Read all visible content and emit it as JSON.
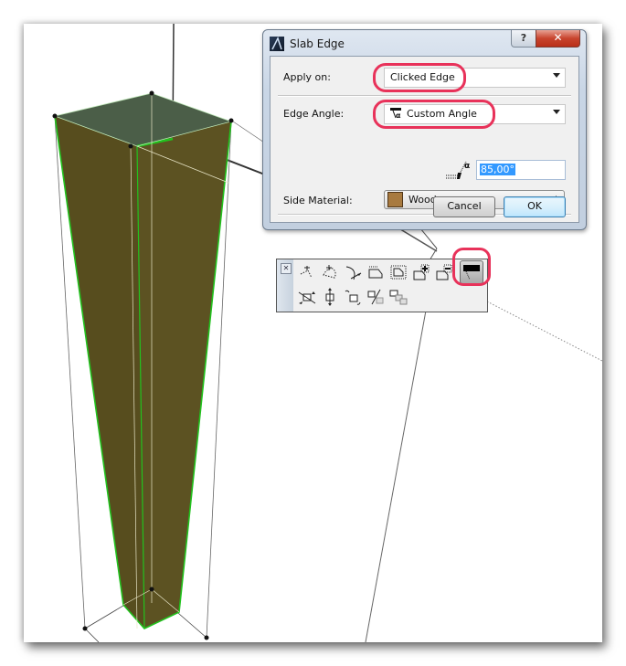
{
  "dialog": {
    "title": "Slab Edge",
    "help_label": "?",
    "close_label": "✕",
    "apply_on": {
      "label": "Apply on:",
      "value": "Clicked Edge"
    },
    "edge_angle": {
      "label": "Edge Angle:",
      "value": "Custom Angle",
      "icon": "custom-angle-icon"
    },
    "angle_value": "85,00°",
    "angle_icon_glyph": "α",
    "side_material": {
      "label": "Side Material:",
      "value": "Wood",
      "swatch_color": "#a87a3f"
    },
    "cancel_label": "Cancel",
    "ok_label": "OK"
  },
  "palette": {
    "close_glyph": "✕",
    "row1": [
      "offset-edge-icon",
      "rotate-edge-icon",
      "curve-edge-icon",
      "offset-all-edges-icon",
      "offset-polygon-icon",
      "add-to-polygon-icon",
      "subtract-from-polygon-icon",
      "custom-edge-settings-icon"
    ],
    "row2": [
      "drag-elevate-icon",
      "elevate-icon",
      "rotate-3d-icon",
      "split-icon",
      "multiply-icon"
    ],
    "active_tool": "custom-edge-settings-icon"
  },
  "highlight_color": "#e8325a",
  "slab_color": "#5a5020",
  "slab_top_color": "#4a5e46",
  "edge_color": "#22c21e"
}
